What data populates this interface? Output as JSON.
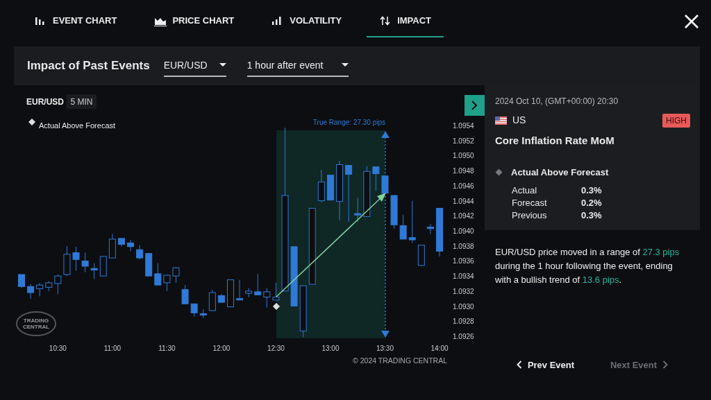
{
  "tabs": [
    {
      "label": "EVENT CHART",
      "selected": false
    },
    {
      "label": "PRICE CHART",
      "selected": false
    },
    {
      "label": "VOLATILITY",
      "selected": false
    },
    {
      "label": "IMPACT",
      "selected": true
    }
  ],
  "header": {
    "title": "Impact of Past Events",
    "pair": "EUR/USD",
    "period": "1 hour after event"
  },
  "chart": {
    "symbol": "EUR/USD",
    "timeframe": "5 MIN",
    "legend": "Actual Above Forecast",
    "range_label": "True Range: 27.30 pips",
    "logo_lines": [
      "TRADING",
      "CENTRAL"
    ],
    "copyright": "© 2024 TRADING CENTRAL",
    "chart_data": {
      "type": "candlestick",
      "categories": [
        null,
        null,
        null,
        null,
        "10:30",
        null,
        null,
        null,
        null,
        null,
        "11:00",
        null,
        null,
        null,
        null,
        null,
        "11:30",
        null,
        null,
        null,
        null,
        null,
        "12:00",
        null,
        null,
        null,
        null,
        null,
        "12:30",
        null,
        null,
        null,
        null,
        null,
        "13:00",
        null,
        null,
        null,
        null,
        null,
        "13:30",
        null,
        null,
        null,
        null,
        null,
        "14:00"
      ],
      "ohlc": [
        [
          1.09342,
          1.09342,
          1.09324,
          1.09326
        ],
        [
          1.09326,
          1.09329,
          1.0931,
          1.09318
        ],
        [
          1.09323,
          1.09331,
          1.09313,
          1.09328
        ],
        [
          1.09325,
          1.09333,
          1.0932,
          1.09331
        ],
        [
          1.0933,
          1.09342,
          1.09316,
          1.0934
        ],
        [
          1.09342,
          1.0938,
          1.0934,
          1.09369
        ],
        [
          1.09371,
          1.09379,
          1.09347,
          1.09362
        ],
        [
          1.0936,
          1.09371,
          1.09345,
          1.09353
        ],
        [
          1.0935,
          1.09357,
          1.09336,
          1.09348
        ],
        [
          1.0934,
          1.09366,
          1.0934,
          1.09366
        ],
        [
          1.09364,
          1.09396,
          1.09364,
          1.09389
        ],
        [
          1.0939,
          1.0939,
          1.09379,
          1.09382
        ],
        [
          1.09384,
          1.09388,
          1.09373,
          1.09379
        ],
        [
          1.09375,
          1.09381,
          1.09362,
          1.09364
        ],
        [
          1.0937,
          1.0937,
          1.0934,
          1.0934
        ],
        [
          1.09343,
          1.09357,
          1.09328,
          1.09328
        ],
        [
          1.09331,
          1.09342,
          1.0932,
          1.09341
        ],
        [
          1.0934,
          1.09352,
          1.09331,
          1.09351
        ],
        [
          1.09322,
          1.09328,
          1.09303,
          1.09303
        ],
        [
          1.09303,
          1.09303,
          1.09286,
          1.09291
        ],
        [
          1.0929,
          1.09296,
          1.09284,
          1.09288
        ],
        [
          1.09294,
          1.09322,
          1.09294,
          1.09318
        ],
        [
          1.09314,
          1.09316,
          1.09305,
          1.09305
        ],
        [
          1.09299,
          1.09335,
          1.09299,
          1.09335
        ],
        [
          1.0931,
          1.09335,
          1.09309,
          1.09309
        ],
        [
          1.09317,
          1.09324,
          1.09312,
          1.0932
        ],
        [
          1.09319,
          1.09343,
          1.09315,
          1.09315
        ],
        [
          1.09312,
          1.09324,
          1.09298,
          1.09319
        ],
        [
          1.09308,
          1.09331,
          1.09308,
          1.09312
        ],
        [
          1.0932,
          1.09537,
          1.0932,
          1.09447
        ],
        [
          1.09379,
          1.09379,
          1.093,
          1.093
        ],
        [
          1.09267,
          1.09327,
          1.09259,
          1.09327
        ],
        [
          1.09329,
          1.0943,
          1.09329,
          1.0943
        ],
        [
          1.0944,
          1.09481,
          1.09438,
          1.09465
        ],
        [
          1.09474,
          1.09474,
          1.0944,
          1.09441
        ],
        [
          1.09439,
          1.09493,
          1.09414,
          1.09488
        ],
        [
          1.09487,
          1.09487,
          1.09412,
          1.09475
        ],
        [
          1.09423,
          1.09444,
          1.09412,
          1.09421
        ],
        [
          1.09419,
          1.09486,
          1.09419,
          1.09479
        ],
        [
          1.09485,
          1.09485,
          1.09453,
          1.09476
        ],
        [
          1.09473,
          1.09473,
          1.0945,
          1.0945
        ],
        [
          1.09447,
          1.09447,
          1.09403,
          1.09408
        ],
        [
          1.09407,
          1.09421,
          1.09389,
          1.09389
        ],
        [
          1.09391,
          1.0944,
          1.09384,
          1.09388
        ],
        [
          1.09354,
          1.09381,
          1.09354,
          1.09381
        ],
        [
          1.09405,
          1.09409,
          1.09396,
          1.09403
        ],
        [
          1.0943,
          1.0943,
          1.09366,
          1.09373
        ]
      ],
      "ylim": [
        1.0926,
        1.0954
      ],
      "yticks": [
        {
          "value": 1.0954,
          "label": "1.0954"
        },
        {
          "value": 1.0952,
          "label": "1.0952"
        },
        {
          "value": 1.095,
          "label": "1.0950"
        },
        {
          "value": 1.0948,
          "label": "1.0948"
        },
        {
          "value": 1.0946,
          "label": "1.0946"
        },
        {
          "value": 1.0944,
          "label": "1.0944"
        },
        {
          "value": 1.0942,
          "label": "1.0942"
        },
        {
          "value": 1.094,
          "label": "1.0940"
        },
        {
          "value": 1.0938,
          "label": "1.0938"
        },
        {
          "value": 1.0936,
          "label": "1.0936"
        },
        {
          "value": 1.0934,
          "label": "1.0934"
        },
        {
          "value": 1.0932,
          "label": "1.0932"
        },
        {
          "value": 1.093,
          "label": "1.0930"
        },
        {
          "value": 1.0928,
          "label": "1.0928"
        },
        {
          "value": 1.0926,
          "label": "1.0926"
        }
      ]
    }
  },
  "event": {
    "datetime": "2024 Oct 10, (GMT+00:00) 20:30",
    "country": "US",
    "impact": "HIGH",
    "title": "Core Inflation Rate MoM",
    "outcome": "Actual Above Forecast",
    "rows": [
      {
        "label": "Actual",
        "value": "0.3%"
      },
      {
        "label": "Forecast",
        "value": "0.2%"
      },
      {
        "label": "Previous",
        "value": "0.3%"
      }
    ]
  },
  "summary": [
    {
      "text": "EUR/USD price moved in a range of ",
      "highlight": false
    },
    {
      "text": "27.3 pips",
      "highlight": true
    },
    {
      "text": " during the 1 hour following the event, ending with a bullish trend of ",
      "highlight": false
    },
    {
      "text": "13.6 pips",
      "highlight": true
    },
    {
      "text": ".",
      "highlight": false
    }
  ],
  "nav": [
    {
      "label": "Prev Event",
      "disabled": false
    },
    {
      "label": "Next Event",
      "disabled": true
    }
  ]
}
